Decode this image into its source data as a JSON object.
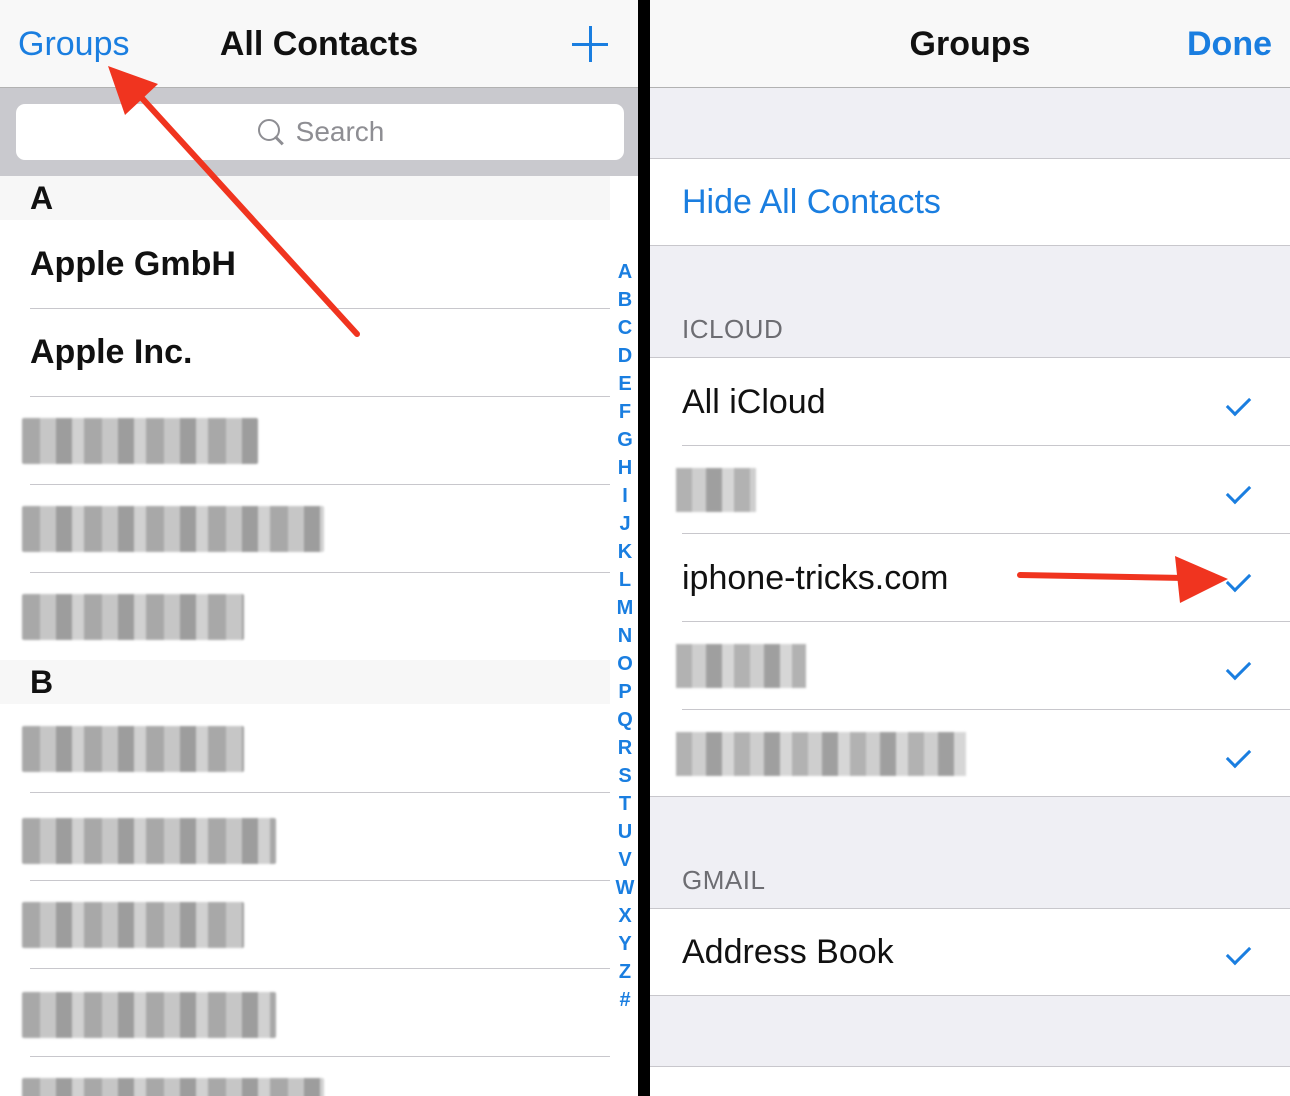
{
  "left": {
    "nav": {
      "groups_label": "Groups",
      "title": "All Contacts",
      "add_icon": "plus-icon"
    },
    "search": {
      "placeholder": "Search",
      "icon": "search-icon"
    },
    "sections": [
      {
        "letter": "A",
        "contacts": [
          "Apple GmbH",
          "Apple Inc."
        ]
      },
      {
        "letter": "B",
        "contacts": []
      }
    ],
    "index_letters": [
      "A",
      "B",
      "C",
      "D",
      "E",
      "F",
      "G",
      "H",
      "I",
      "J",
      "K",
      "L",
      "M",
      "N",
      "O",
      "P",
      "Q",
      "R",
      "S",
      "T",
      "U",
      "V",
      "W",
      "X",
      "Y",
      "Z",
      "#"
    ]
  },
  "right": {
    "nav": {
      "title": "Groups",
      "done_label": "Done"
    },
    "hide_all": "Hide All Contacts",
    "icloud": {
      "header": "ICLOUD",
      "items": [
        {
          "label": "All iCloud",
          "checked": true
        },
        {
          "label": "",
          "checked": true
        },
        {
          "label": "iphone-tricks.com",
          "checked": true
        },
        {
          "label": "",
          "checked": true
        },
        {
          "label": "",
          "checked": true
        }
      ]
    },
    "gmail": {
      "header": "GMAIL",
      "items": [
        {
          "label": "Address Book",
          "checked": true
        }
      ]
    }
  },
  "colors": {
    "accent": "#1a7ee0",
    "annotation_arrow": "#f0341f"
  }
}
